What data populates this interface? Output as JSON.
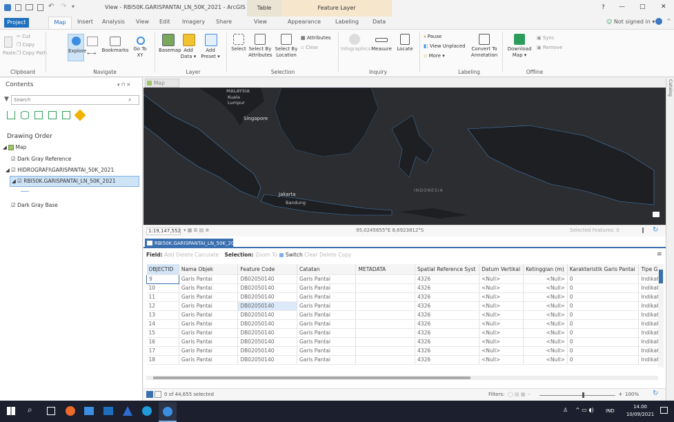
{
  "window": {
    "title": "View - RBI50K.GARISPANTAI_LN_50K_2021 - ArcGIS Pro",
    "help": "?",
    "controls": [
      "—",
      "□",
      "✕"
    ],
    "ctx_table": "Table",
    "ctx_feature_layer": "Feature Layer",
    "signin": "Not signed in ▾"
  },
  "tabs": [
    "Project",
    "Map",
    "Insert",
    "Analysis",
    "View",
    "Edit",
    "Imagery",
    "Share",
    "View",
    "Appearance",
    "Labeling",
    "Data"
  ],
  "ribbon": {
    "clipboard": {
      "cut": "Cut",
      "copy": "Copy",
      "paste": "Paste",
      "copy_path": "Copy Path",
      "group": "Clipboard"
    },
    "navigate": {
      "explore": "Explore",
      "bookmarks": "Bookmarks",
      "goto": "Go To XY",
      "group": "Navigate"
    },
    "layer": {
      "basemap": "Basemap",
      "add_data": "Add Data ▾",
      "add_preset": "Add Preset ▾",
      "group": "Layer"
    },
    "selection": {
      "select": "Select",
      "by_attr": "Select By Attributes",
      "by_loc": "Select By Location",
      "attributes": "Attributes",
      "clear": "Clear",
      "group": "Selection"
    },
    "inquiry": {
      "infographics": "Infographics",
      "measure": "Measure",
      "locate": "Locate",
      "group": "Inquiry"
    },
    "labeling": {
      "pause": "Pause",
      "view_unplaced": "View Unplaced",
      "more": "More ▾",
      "convert": "Convert To Annotation",
      "group": "Labeling"
    },
    "offline": {
      "download": "Download Map ▾",
      "sync": "Sync",
      "remove": "Remove",
      "group": "Offline"
    }
  },
  "contents": {
    "title": "Contents",
    "pin": "▾ ⊓ ✕",
    "search_placeholder": "Search",
    "drawing_order": "Drawing Order",
    "layers": [
      "Map",
      "Dark Gray Reference",
      "HIDROGRAFI\\GARISPANTAI_50K_2021",
      "RBI50K.GARISPANTAI_LN_50K_2021",
      "Dark Gray Base"
    ]
  },
  "map": {
    "tab": "Map",
    "labels": [
      "MALAYSIA",
      "Kuala Lumpur",
      "Singapore",
      "Jakarta",
      "Bandung",
      "INDONESIA"
    ],
    "scale": "1:19,147,552",
    "coords": "95,0245655°E 8,6923812°S",
    "selected_features": "Selected Features: 0"
  },
  "table": {
    "tab": "RBI50K.GARISPANTAI_LN_50K_2021",
    "toolbar": {
      "field": "Field:",
      "add": "Add",
      "delete": "Delete",
      "calculate": "Calculate",
      "selection": "Selection:",
      "zoom_to": "Zoom To",
      "switch": "Switch",
      "clear": "Clear",
      "delete2": "Delete",
      "copy": "Copy"
    },
    "columns": [
      "OBJECTID",
      "Nama Objek",
      "Feature Code",
      "Catatan",
      "METADATA",
      "Spatial Reference Syst",
      "Datum Vertikal",
      "Ketinggian (m)",
      "Karakteristik Garis Pantai",
      "Tipe Garis"
    ],
    "rows": [
      [
        "9",
        "Garis Pantai",
        "DB02050140",
        "Garis Pantai",
        "",
        "4326",
        "<Null>",
        "<Null>",
        "0",
        "Indikatif"
      ],
      [
        "10",
        "Garis Pantai",
        "DB02050140",
        "Garis Pantai",
        "",
        "4326",
        "<Null>",
        "<Null>",
        "0",
        "Indikatif"
      ],
      [
        "11",
        "Garis Pantai",
        "DB02050140",
        "Garis Pantai",
        "",
        "4326",
        "<Null>",
        "<Null>",
        "0",
        "Indikatif"
      ],
      [
        "12",
        "Garis Pantai",
        "DB02050140",
        "Garis Pantai",
        "",
        "4326",
        "<Null>",
        "<Null>",
        "0",
        "Indikatif"
      ],
      [
        "13",
        "Garis Pantai",
        "DB02050140",
        "Garis Pantai",
        "",
        "4326",
        "<Null>",
        "<Null>",
        "0",
        "Indikatif"
      ],
      [
        "14",
        "Garis Pantai",
        "DB02050140",
        "Garis Pantai",
        "",
        "4326",
        "<Null>",
        "<Null>",
        "0",
        "Indikatif"
      ],
      [
        "15",
        "Garis Pantai",
        "DB02050140",
        "Garis Pantai",
        "",
        "4326",
        "<Null>",
        "<Null>",
        "0",
        "Indikatif"
      ],
      [
        "16",
        "Garis Pantai",
        "DB02050140",
        "Garis Pantai",
        "",
        "4326",
        "<Null>",
        "<Null>",
        "0",
        "Indikatif"
      ],
      [
        "17",
        "Garis Pantai",
        "DB02050140",
        "Garis Pantai",
        "",
        "4326",
        "<Null>",
        "<Null>",
        "0",
        "Indikatif"
      ],
      [
        "18",
        "Garis Pantai",
        "DB02050140",
        "Garis Pantai",
        "",
        "4326",
        "<Null>",
        "<Null>",
        "0",
        "Indikatif"
      ]
    ],
    "status": "0 of 44,655 selected",
    "filters": "Filters:",
    "zoom": "100%"
  },
  "catalog_tab": "Catalog",
  "taskbar": {
    "lang": "IND",
    "time": "14.00",
    "date": "10/09/2021"
  },
  "colors": {
    "accent": "#1f6fbf",
    "project_tab": "#1f6fbf",
    "table_header": "#3a6fb0",
    "map_bg": "#2b2d30",
    "land": "#1d1f22"
  }
}
